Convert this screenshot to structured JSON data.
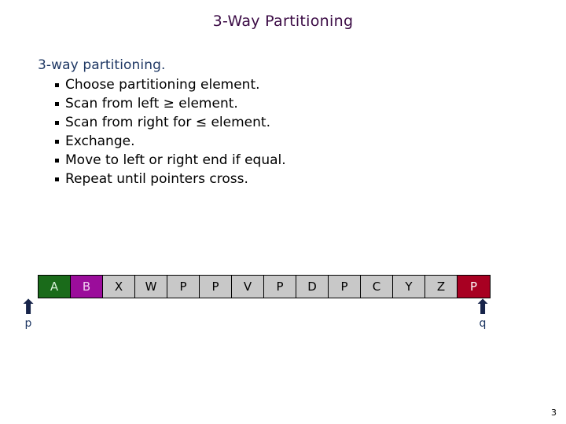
{
  "slide": {
    "title": "3-Way Partitioning",
    "page_number": "3",
    "title_color": "#3B0B45",
    "lead_color": "#1F3864",
    "bullet_color": "#000000"
  },
  "content": {
    "lead": "3-way partitioning.",
    "bullets": [
      "Choose partitioning element.",
      "Scan from left ≥ element.",
      "Scan from right for ≤  element.",
      "Exchange.",
      "Move to left or right end if equal.",
      "Repeat until pointers cross."
    ]
  },
  "array": {
    "cells": [
      {
        "value": "A",
        "style": "green"
      },
      {
        "value": "B",
        "style": "purple"
      },
      {
        "value": "X",
        "style": "plain"
      },
      {
        "value": "W",
        "style": "plain"
      },
      {
        "value": "P",
        "style": "plain"
      },
      {
        "value": "P",
        "style": "plain"
      },
      {
        "value": "V",
        "style": "plain"
      },
      {
        "value": "P",
        "style": "plain"
      },
      {
        "value": "D",
        "style": "plain"
      },
      {
        "value": "P",
        "style": "plain"
      },
      {
        "value": "C",
        "style": "plain"
      },
      {
        "value": "Y",
        "style": "plain"
      },
      {
        "value": "Z",
        "style": "plain"
      },
      {
        "value": "P",
        "style": "red"
      }
    ],
    "colors": {
      "plain": "#C8C8C8",
      "green": "#1A6B1A",
      "purple": "#9B0D9B",
      "red": "#A80022",
      "border": "#000000"
    }
  },
  "pointers": {
    "left": {
      "label": "p",
      "arrow": "⬆",
      "color": "#1F3864"
    },
    "right": {
      "label": "q",
      "arrow": "⬆",
      "color": "#1F3864"
    }
  }
}
